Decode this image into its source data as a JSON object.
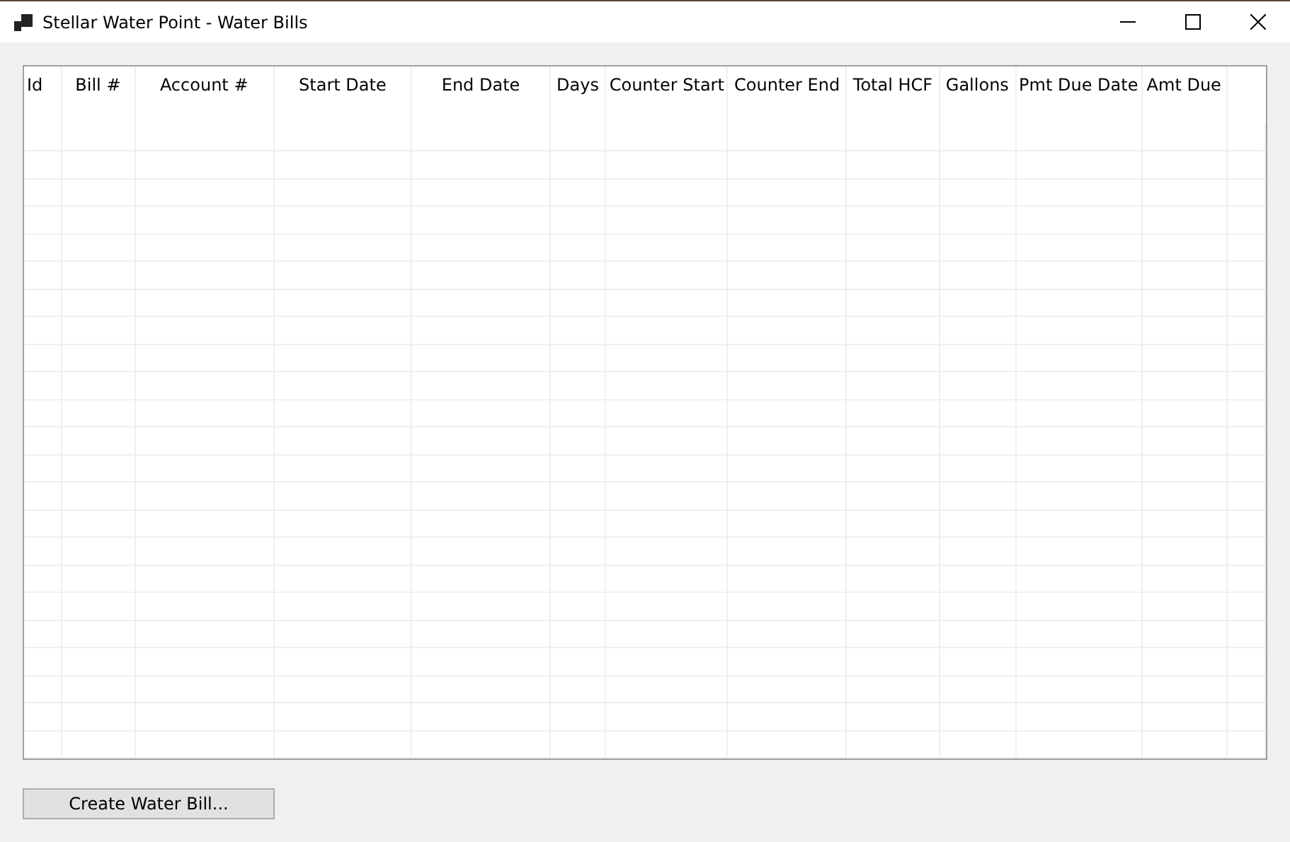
{
  "window": {
    "title": "Stellar Water Point - Water Bills",
    "controls": [
      {
        "kind": "minimize"
      },
      {
        "kind": "maximize"
      },
      {
        "kind": "close"
      }
    ]
  },
  "table": {
    "columns": [
      "Id",
      "Bill #",
      "Account #",
      "Start Date",
      "End Date",
      "Days",
      "Counter Start",
      "Counter End",
      "Total HCF",
      "Gallons",
      "Pmt Due Date",
      "Amt Due"
    ]
  },
  "buttons": [
    "Create Water Bill..."
  ]
}
